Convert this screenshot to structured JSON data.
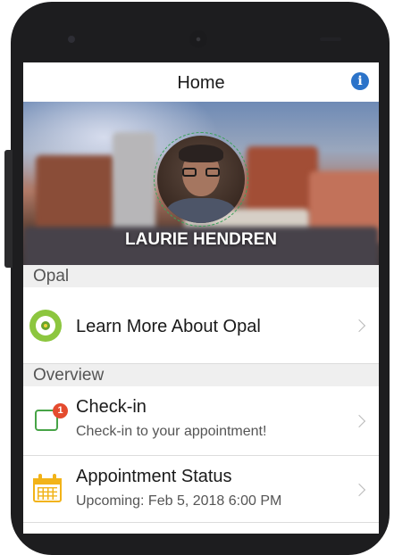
{
  "header": {
    "title": "Home",
    "info_icon": "info-icon",
    "info_glyph": "i"
  },
  "banner": {
    "user_name": "LAURIE HENDREN",
    "avatar_icon": "avatar-photo"
  },
  "sections": {
    "opal": "Opal",
    "overview": "Overview"
  },
  "opal_items": [
    {
      "label": "Learn More About Opal",
      "icon": "opal-logo-icon"
    }
  ],
  "overview_items": [
    {
      "title": "Check-in",
      "subtitle": "Check-in to your appointment!",
      "icon": "check-in-icon",
      "badge_count": "1"
    },
    {
      "title": "Appointment Status",
      "subtitle": "Upcoming: Feb 5, 2018 6:00 PM",
      "icon": "calendar-icon"
    }
  ],
  "colors": {
    "accent_blue": "#2b73c9",
    "opal_green": "#8cc63f",
    "checkin_green": "#47a447",
    "badge_red": "#e44b2e",
    "calendar_yellow": "#f2b318"
  }
}
